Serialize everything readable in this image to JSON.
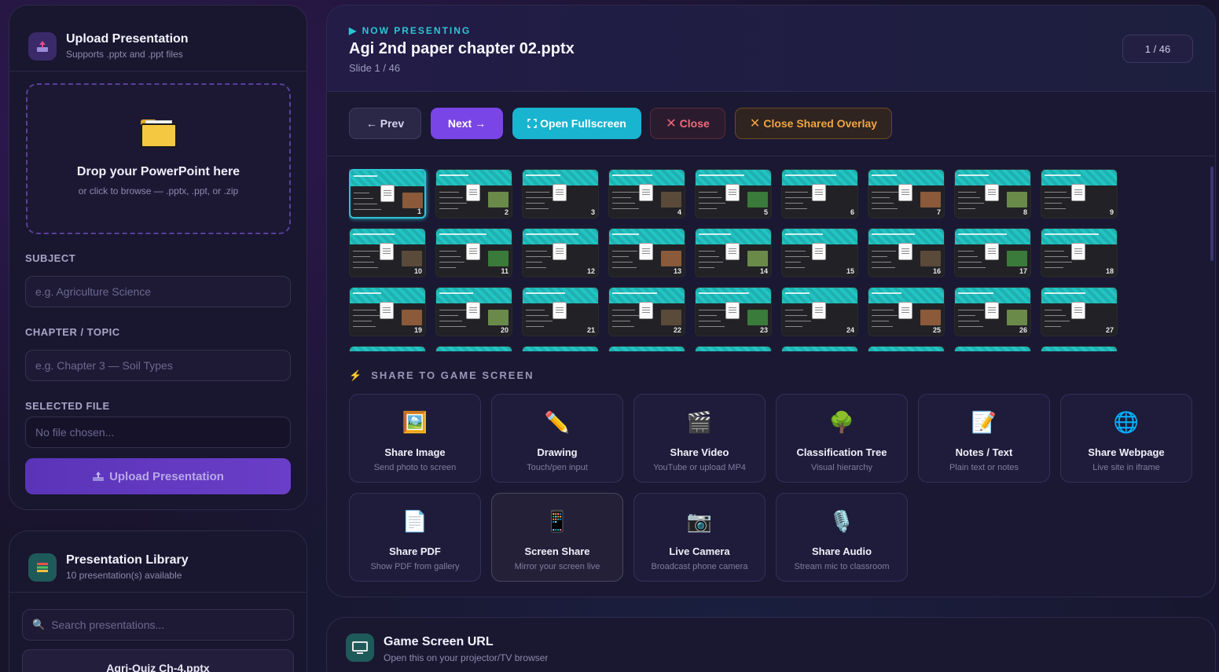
{
  "upload": {
    "title": "Upload Presentation",
    "subtitle": "Supports .pptx and .ppt files",
    "drop_title": "Drop your PowerPoint here",
    "drop_sub": "or click to browse — .pptx, .ppt, or .zip",
    "subject_label": "SUBJECT",
    "subject_placeholder": "e.g. Agriculture Science",
    "chapter_label": "CHAPTER / TOPIC",
    "chapter_placeholder": "e.g. Chapter 3 — Soil Types",
    "file_label": "SELECTED FILE",
    "file_value": "No file chosen...",
    "button_label": "Upload Presentation"
  },
  "library": {
    "title": "Presentation Library",
    "subtitle": "10 presentation(s) available",
    "search_placeholder": "Search presentations...",
    "first_item": "Agri-Quiz Ch-4.pptx"
  },
  "presenting": {
    "label": "▶ NOW PRESENTING",
    "file": "Agi 2nd paper chapter 02.pptx",
    "slide_info": "Slide 1 / 46",
    "counter": "1 / 46"
  },
  "controls": {
    "prev": "← Prev",
    "next": "Next →",
    "fullscreen": "Open Fullscreen",
    "close": "Close",
    "close_overlay": "Close Shared Overlay"
  },
  "thumbnails": [
    "1",
    "2",
    "3",
    "4",
    "5",
    "6",
    "7",
    "8",
    "9",
    "10",
    "11",
    "12",
    "13",
    "14",
    "15",
    "16",
    "17",
    "18",
    "19",
    "20",
    "21",
    "22",
    "23",
    "24",
    "25",
    "26",
    "27"
  ],
  "share": {
    "label": "SHARE TO GAME SCREEN",
    "cards": [
      {
        "title": "Share Image",
        "sub": "Send photo to screen",
        "icon": "image-icon"
      },
      {
        "title": "Drawing",
        "sub": "Touch/pen input",
        "icon": "pencil-icon"
      },
      {
        "title": "Share Video",
        "sub": "YouTube or upload MP4",
        "icon": "clapper-icon"
      },
      {
        "title": "Classification Tree",
        "sub": "Visual hierarchy",
        "icon": "tree-icon"
      },
      {
        "title": "Notes / Text",
        "sub": "Plain text or notes",
        "icon": "notes-icon"
      },
      {
        "title": "Share Webpage",
        "sub": "Live site in iframe",
        "icon": "globe-icon"
      },
      {
        "title": "Share PDF",
        "sub": "Show PDF from gallery",
        "icon": "pdf-icon"
      },
      {
        "title": "Screen Share",
        "sub": "Mirror your screen live",
        "icon": "phone-icon"
      },
      {
        "title": "Live Camera",
        "sub": "Broadcast phone camera",
        "icon": "camera-icon"
      },
      {
        "title": "Share Audio",
        "sub": "Stream mic to classroom",
        "icon": "microphone-icon"
      }
    ]
  },
  "game": {
    "title": "Game Screen URL",
    "subtitle": "Open this on your projector/TV browser"
  }
}
